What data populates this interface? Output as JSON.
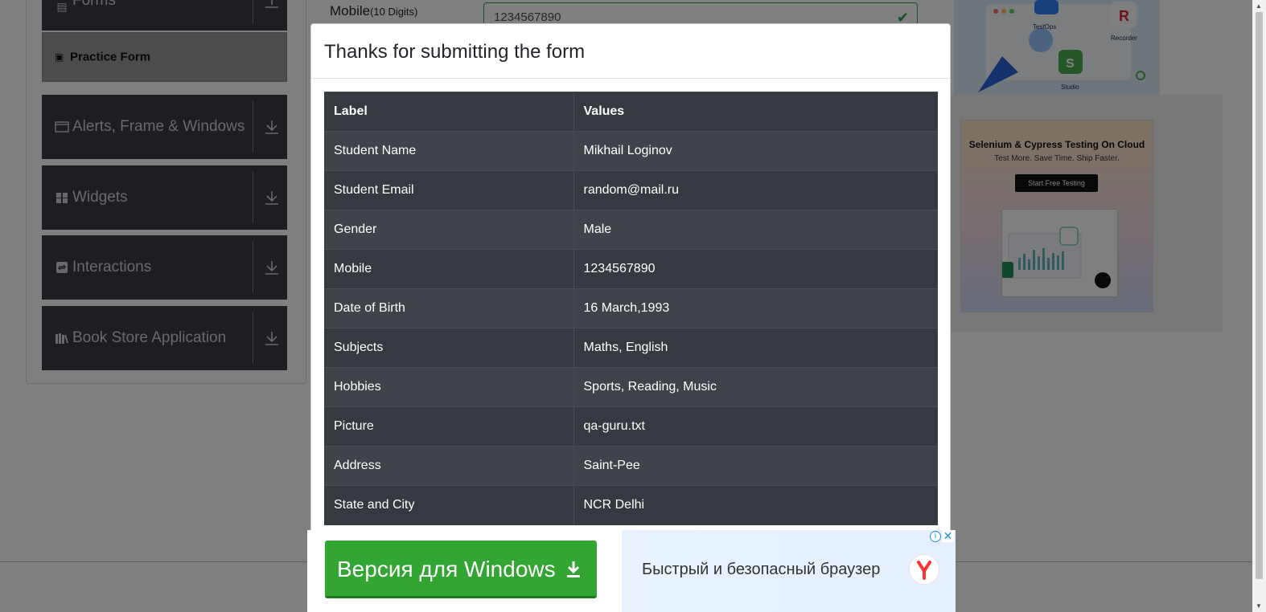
{
  "sidebar": {
    "forms_label": "Forms",
    "practice_form_label": "Practice Form",
    "groups": [
      {
        "label": "Alerts, Frame & Windows",
        "icon": "window-icon"
      },
      {
        "label": "Widgets",
        "icon": "widgets-icon"
      },
      {
        "label": "Interactions",
        "icon": "interactions-icon"
      },
      {
        "label": "Book Store Application",
        "icon": "books-icon"
      }
    ]
  },
  "form": {
    "mobile_label": "Mobile",
    "mobile_hint": "(10 Digits)",
    "mobile_value": "1234567890"
  },
  "ads": {
    "right_top": {
      "labels": [
        "TestOps",
        "Recorder",
        "Studio"
      ]
    },
    "right_card": {
      "title": "Selenium & Cypress Testing On Cloud",
      "subtitle": "Test More. Save Time. Ship Faster.",
      "cta": "Start Free Testing"
    },
    "bottom": {
      "button_label": "Версия для Windows",
      "slogan": "Быстрый и безопасный браузер",
      "info_glyph": "i",
      "close_glyph": "✕"
    }
  },
  "modal": {
    "title": "Thanks for submitting the form",
    "columns": [
      "Label",
      "Values"
    ],
    "rows": [
      {
        "label": "Student Name",
        "value": "Mikhail Loginov"
      },
      {
        "label": "Student Email",
        "value": "random@mail.ru"
      },
      {
        "label": "Gender",
        "value": "Male"
      },
      {
        "label": "Mobile",
        "value": "1234567890"
      },
      {
        "label": "Date of Birth",
        "value": "16 March,1993"
      },
      {
        "label": "Subjects",
        "value": "Maths, English"
      },
      {
        "label": "Hobbies",
        "value": "Sports, Reading, Music"
      },
      {
        "label": "Picture",
        "value": "qa-guru.txt"
      },
      {
        "label": "Address",
        "value": "Saint-Pee"
      },
      {
        "label": "State and City",
        "value": "NCR Delhi"
      }
    ]
  },
  "colors": {
    "sidebar_bg": "#383c42",
    "table_bg": "#343a40",
    "valid_green": "#28a745",
    "ad_green": "#33a533"
  }
}
